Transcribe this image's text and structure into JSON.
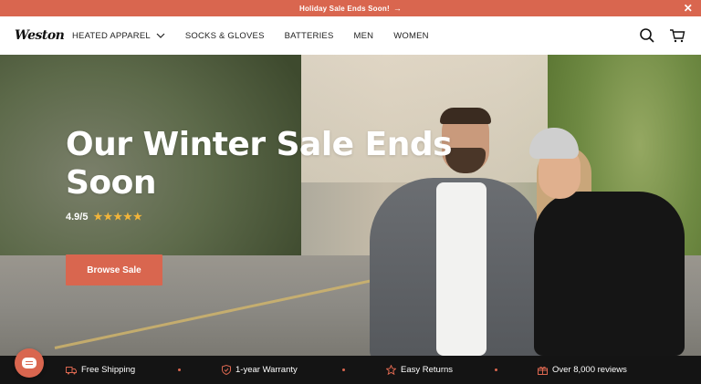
{
  "announcement": {
    "text": "Holiday Sale Ends Soon!",
    "arrow": "→",
    "close": "✕"
  },
  "header": {
    "logo": "Weston",
    "nav": [
      {
        "label": "HEATED APPAREL",
        "has_dropdown": true
      },
      {
        "label": "SOCKS & GLOVES"
      },
      {
        "label": "BATTERIES"
      },
      {
        "label": "MEN"
      },
      {
        "label": "WOMEN"
      }
    ],
    "icons": [
      "search-icon",
      "cart-icon"
    ]
  },
  "hero": {
    "title": "Our Winter Sale Ends Soon",
    "rating": "4.9/5",
    "stars": "★★★★★",
    "button_label": "Browse Sale"
  },
  "features": [
    {
      "label": "Free Shipping",
      "icon": "truck-icon"
    },
    {
      "label": "1-year Warranty",
      "icon": "shield-icon"
    },
    {
      "label": "Easy Returns",
      "icon": "star-icon"
    },
    {
      "label": "Over 8,000 reviews",
      "icon": "gift-icon"
    }
  ],
  "colors": {
    "accent": "#d9664f",
    "footer_bg": "#141414",
    "star": "#f2b53a"
  }
}
